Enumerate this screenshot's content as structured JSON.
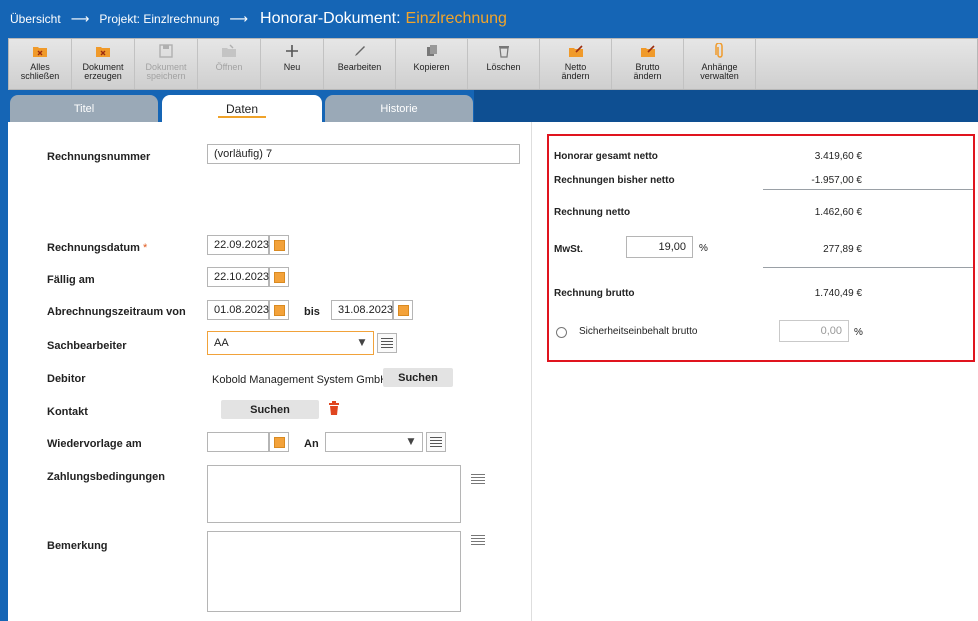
{
  "breadcrumb": {
    "items": [
      "Übersicht",
      "Projekt: Einzlrechnung"
    ],
    "arrow": "⟶",
    "doc_title": "Honorar-Dokument:",
    "doc_name": "Einzlrechnung"
  },
  "toolbar": {
    "buttons": [
      {
        "label": "Alles\nschließen",
        "icon": "folder-close-icon",
        "enabled": true
      },
      {
        "label": "Dokument\nerzeugen",
        "icon": "folder-create-icon",
        "enabled": true
      },
      {
        "label": "Dokument\nspeichern",
        "icon": "save-icon",
        "enabled": false
      },
      {
        "label": "Öffnen",
        "icon": "open-icon",
        "enabled": false
      },
      {
        "label": "Neu",
        "icon": "plus-icon",
        "enabled": true
      },
      {
        "label": "Bearbeiten",
        "icon": "pencil-icon",
        "enabled": true
      },
      {
        "label": "Kopieren",
        "icon": "copy-icon",
        "enabled": true
      },
      {
        "label": "Löschen",
        "icon": "trash-icon",
        "enabled": true
      },
      {
        "label": "Netto\nändern",
        "icon": "folder-edit-icon",
        "enabled": true
      },
      {
        "label": "Brutto\nändern",
        "icon": "folder-edit-icon",
        "enabled": true
      },
      {
        "label": "Anhänge\nverwalten",
        "icon": "paperclip-icon",
        "enabled": true
      }
    ]
  },
  "tabs": [
    {
      "label": "Titel",
      "active": false
    },
    {
      "label": "Daten",
      "active": true
    },
    {
      "label": "Historie",
      "active": false
    }
  ],
  "form": {
    "rechnungsnummer_label": "Rechnungsnummer",
    "rechnungsnummer_value": "(vorläufig) 7",
    "rechnungsdatum_label": "Rechnungsdatum",
    "required_mark": "*",
    "rechnungsdatum_value": "22.09.2023",
    "faellig_label": "Fällig am",
    "faellig_value": "22.10.2023",
    "zeitraum_label": "Abrechnungszeitraum von",
    "zeitraum_von": "01.08.2023",
    "bis_label": "bis",
    "zeitraum_bis": "31.08.2023",
    "sachbearbeiter_label": "Sachbearbeiter",
    "sachbearbeiter_value": "AA",
    "debitor_label": "Debitor",
    "debitor_value": "Kobold Management System GmbH",
    "suchen_label": "Suchen",
    "kontakt_label": "Kontakt",
    "wiedervorlage_label": "Wiedervorlage am",
    "an_label": "An",
    "zahlungsbedingungen_label": "Zahlungsbedingungen",
    "bemerkung_label": "Bemerkung"
  },
  "summary": {
    "honorar_gesamt_label": "Honorar gesamt netto",
    "honorar_gesamt_value": "3.419,60 €",
    "bisher_label": "Rechnungen bisher netto",
    "bisher_value": "-1.957,00 €",
    "netto_label": "Rechnung netto",
    "netto_value": "1.462,60 €",
    "mwst_label": "MwSt.",
    "mwst_rate": "19,00",
    "percent": "%",
    "mwst_value": "277,89 €",
    "brutto_label": "Rechnung brutto",
    "brutto_value": "1.740,49 €",
    "sicherheit_label": "Sicherheitseinbehalt brutto",
    "sicherheit_value": "0,00"
  },
  "colors": {
    "brand_blue": "#1565b5",
    "accent_orange": "#f0a32a",
    "highlight_red": "#e0141e"
  }
}
